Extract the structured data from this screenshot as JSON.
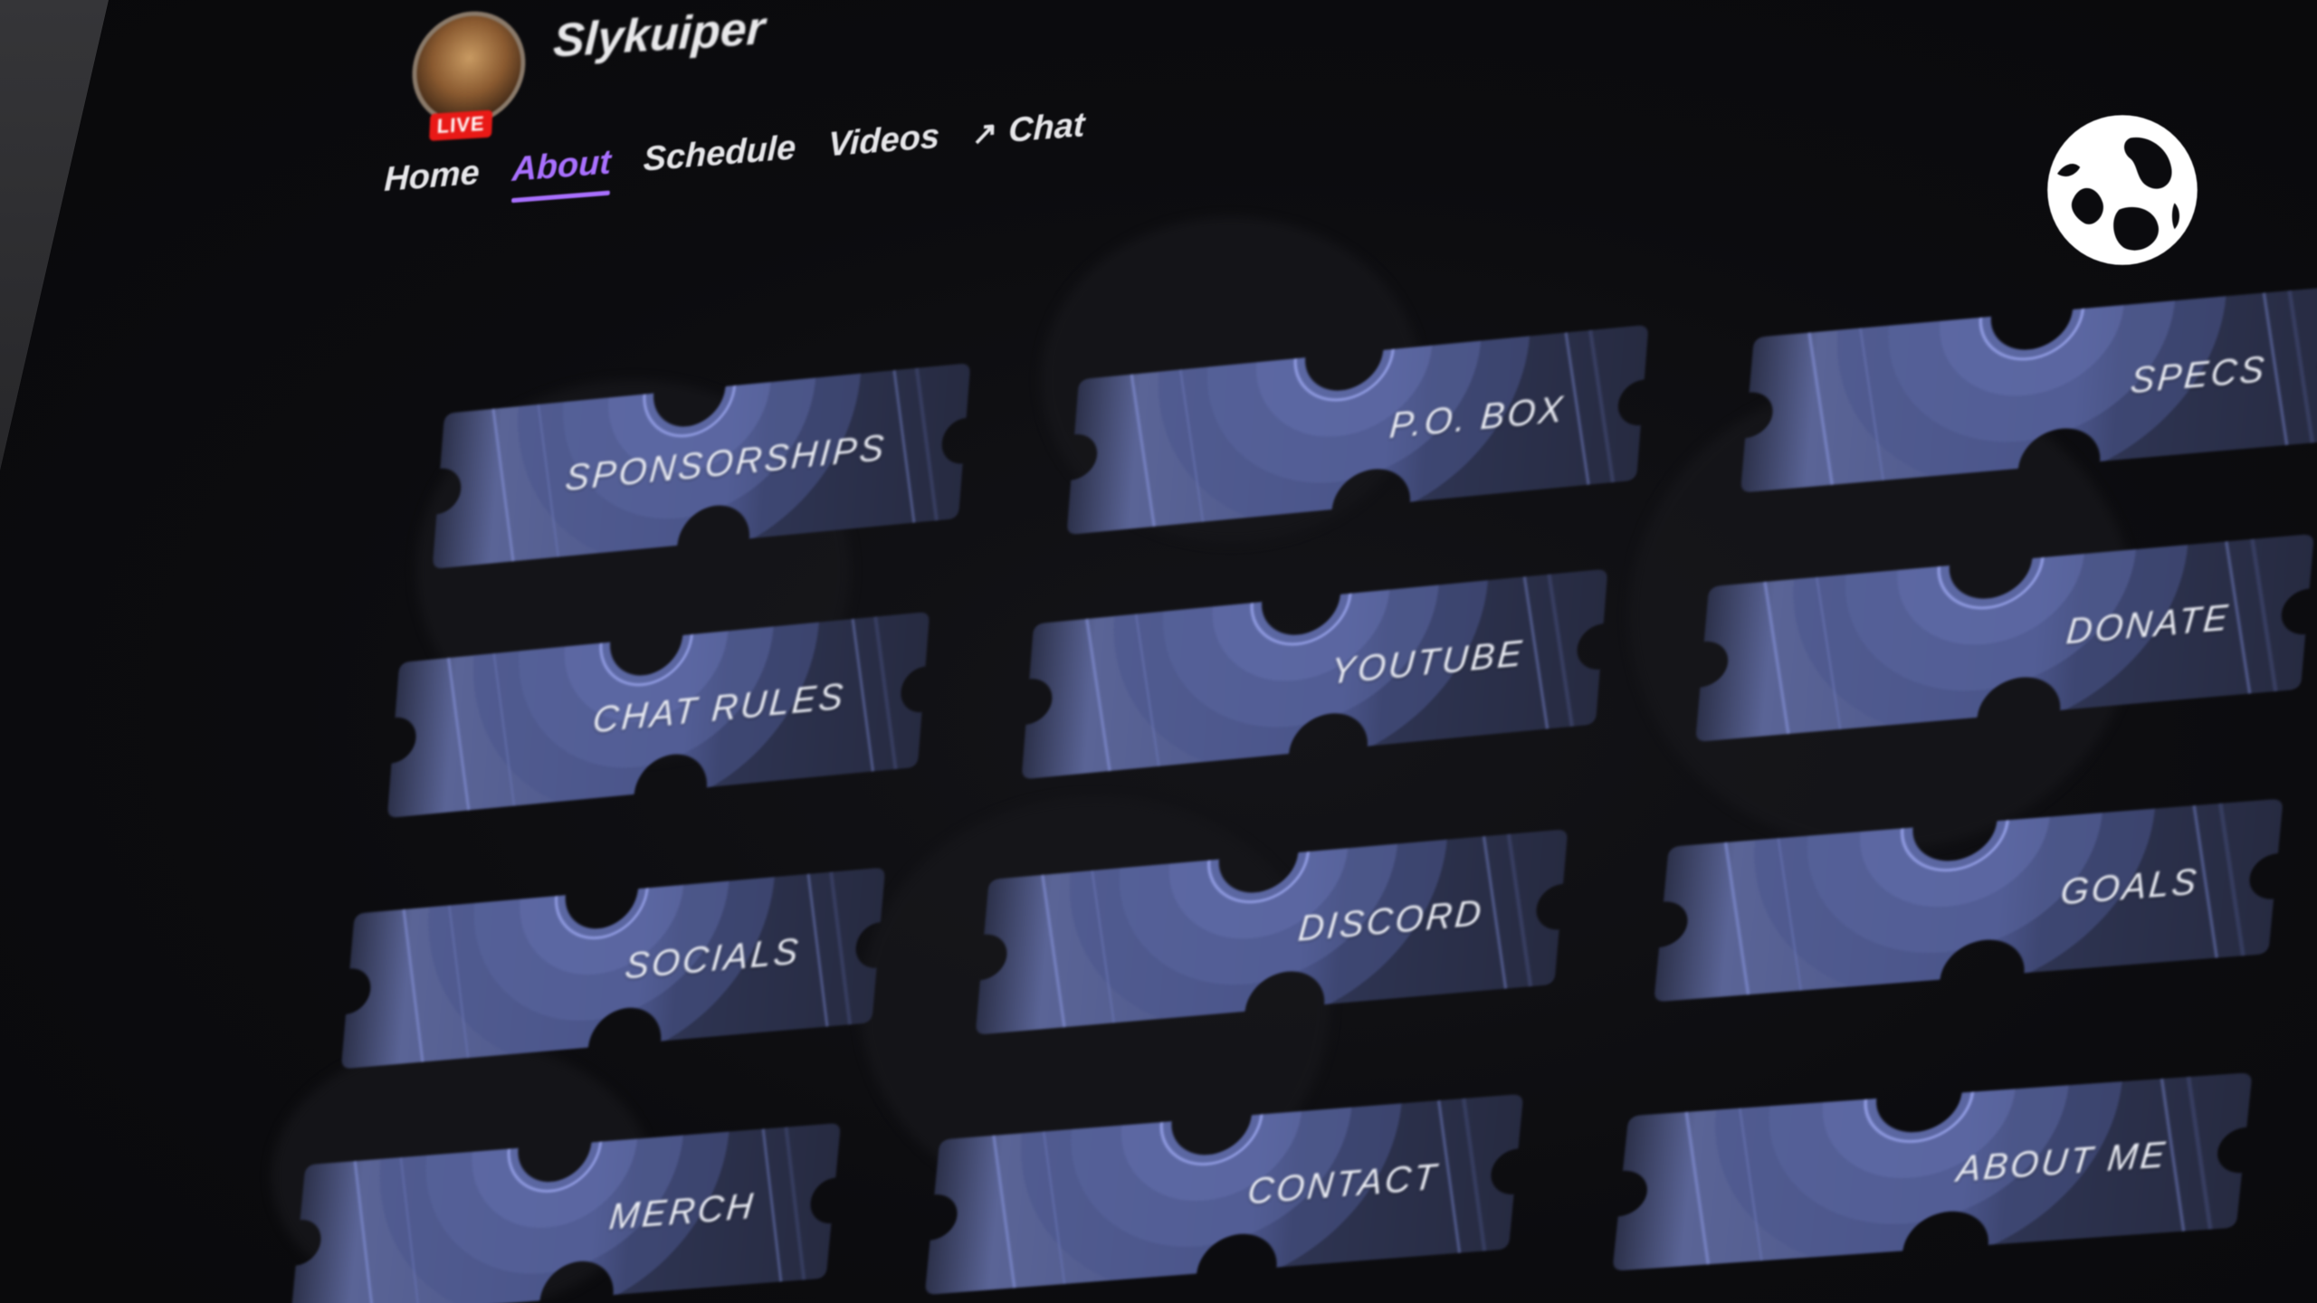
{
  "channel": {
    "name": "Slykuiper",
    "live_badge": "LIVE",
    "avatar": "avatar-photo"
  },
  "nav": {
    "tabs": [
      {
        "label": "Home",
        "active": false
      },
      {
        "label": "About",
        "active": true
      },
      {
        "label": "Schedule",
        "active": false
      },
      {
        "label": "Videos",
        "active": false
      },
      {
        "label": "Chat",
        "active": false,
        "icon": "external-arrow-icon"
      }
    ]
  },
  "logo": {
    "icon": "globe-logo-icon"
  },
  "panels": [
    {
      "label": "SPONSORSHIPS"
    },
    {
      "label": "P.O. BOX"
    },
    {
      "label": "SPECS"
    },
    {
      "label": "CHAT RULES"
    },
    {
      "label": "YOUTUBE"
    },
    {
      "label": "DONATE"
    },
    {
      "label": "SOCIALS"
    },
    {
      "label": "DISCORD"
    },
    {
      "label": "GOALS"
    },
    {
      "label": "MERCH"
    },
    {
      "label": "CONTACT"
    },
    {
      "label": "ABOUT ME"
    }
  ],
  "colors": {
    "accent": "#a970ff",
    "live": "#e91916",
    "panel_light": "#5a6496",
    "panel_dark": "#262a40",
    "background": "#0b0b0e"
  }
}
